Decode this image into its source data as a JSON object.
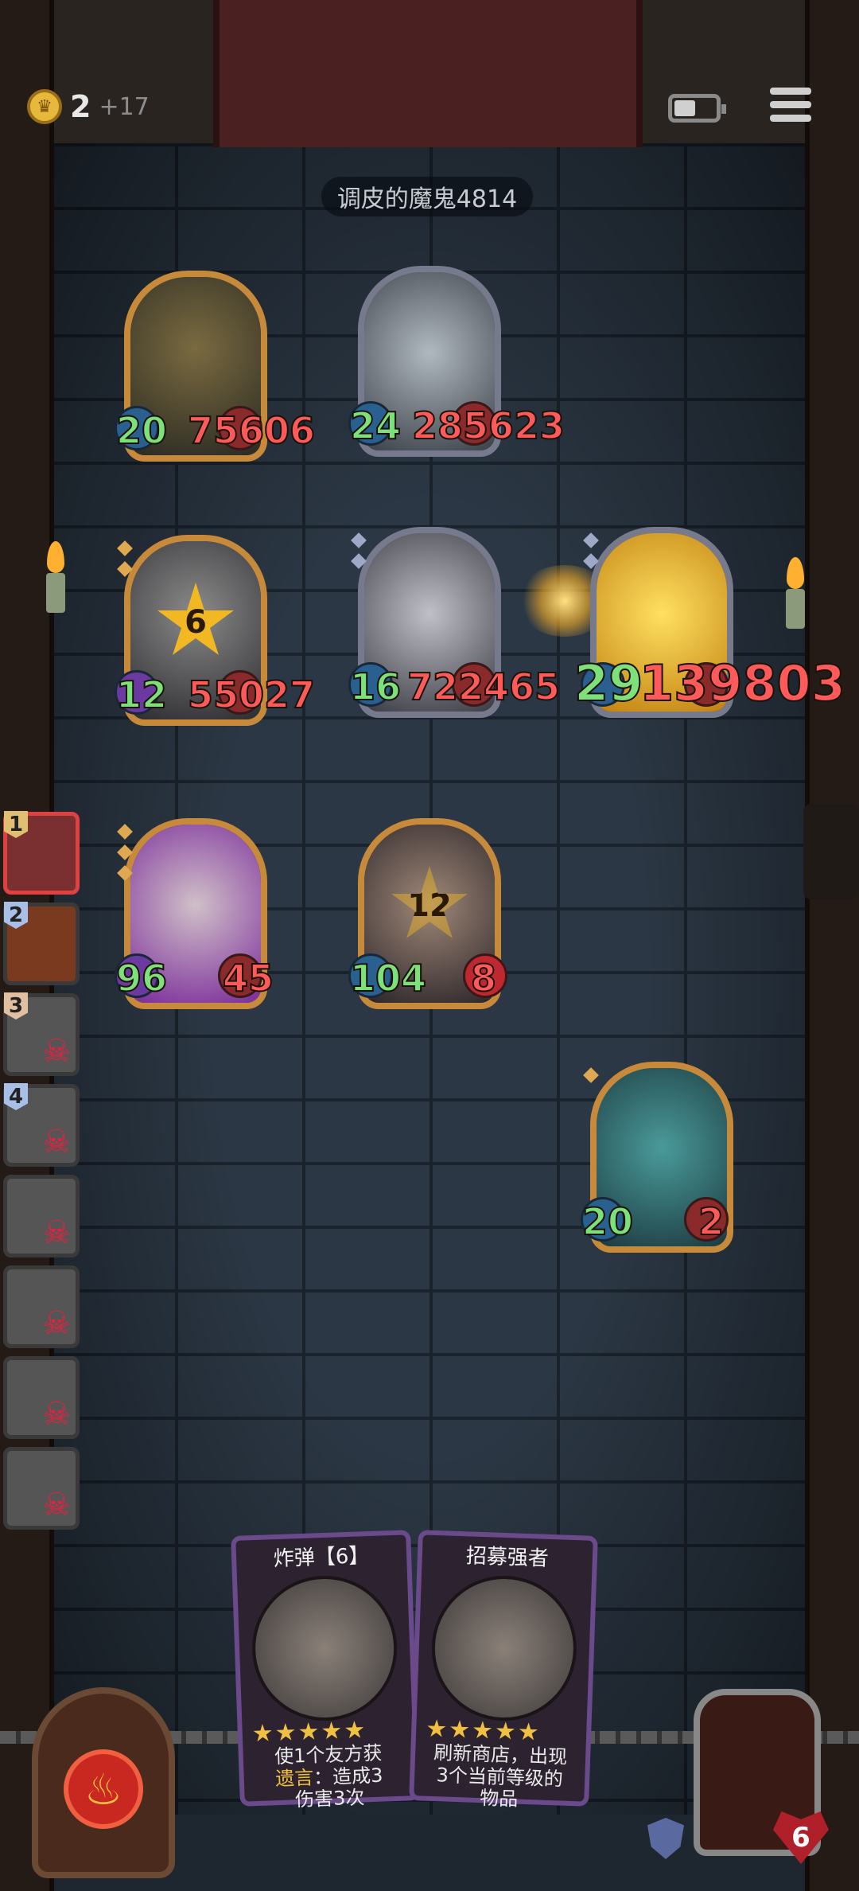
{
  "top": {
    "gold": "2",
    "gold_income": "+17",
    "opponent_name": "调皮的魔鬼4814"
  },
  "opponent_row": [
    {
      "name": "wizard-unit",
      "attack": "20",
      "health": "75606",
      "frame": "gold"
    },
    {
      "name": "beast-unit",
      "attack": "24",
      "health": "285623",
      "frame": "silver"
    }
  ],
  "middle_row": [
    {
      "name": "dragon-unit",
      "attack": "12",
      "health": "55027",
      "frame": "gold",
      "star_value": "6"
    },
    {
      "name": "bone-dragon-unit",
      "attack": "16",
      "health": "722465",
      "frame": "silver"
    },
    {
      "name": "golden-unit",
      "attack": "29",
      "health": "139803",
      "frame": "silver"
    }
  ],
  "player_row": [
    {
      "name": "eagle-unit",
      "attack": "96",
      "health": "45",
      "frame": "gold"
    },
    {
      "name": "magistrate-unit",
      "attack": "104",
      "health": "8",
      "frame": "gold",
      "overlay_value": "12"
    }
  ],
  "lone_unit": {
    "name": "serpent-unit",
    "attack": "20",
    "health": "2",
    "frame": "gold"
  },
  "queue": [
    {
      "num": "1",
      "state": "active"
    },
    {
      "num": "2",
      "state": "alive"
    },
    {
      "num": "3",
      "state": "dead"
    },
    {
      "num": "4",
      "state": "dead"
    },
    {
      "num": "",
      "state": "dead"
    },
    {
      "num": "",
      "state": "dead"
    },
    {
      "num": "",
      "state": "dead"
    },
    {
      "num": "",
      "state": "dead"
    }
  ],
  "shop": [
    {
      "title": "炸弹【6】",
      "stars": "★★★★★",
      "line1": "使1个友方获",
      "keyword": "遗言",
      "line2": "：造成3",
      "line3": "伤害3次"
    },
    {
      "title": "招募强者",
      "stars": "★★★★★",
      "line1": "刷新商店，出现",
      "keyword": "",
      "line2": "3个当前等级的",
      "line3": "物品"
    }
  ],
  "hero": {
    "health": "6"
  },
  "colors": {
    "attack": "#7ee07a",
    "health": "#ff5a5a",
    "gold_frame": "#c7893a",
    "silver_frame": "#767a8c"
  }
}
